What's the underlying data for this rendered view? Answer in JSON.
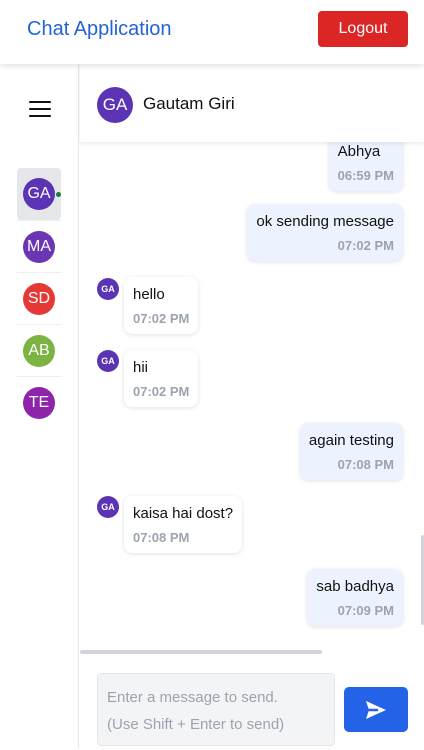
{
  "app": {
    "title": "Chat Application",
    "logout_label": "Logout"
  },
  "sidebar": {
    "menu_icon": "hamburger-menu-icon",
    "contacts": [
      {
        "initials": "GA",
        "color": "#5b34b5",
        "active": true,
        "online": true
      },
      {
        "initials": "MA",
        "color": "#6a36b4"
      },
      {
        "initials": "SD",
        "color": "#e53935"
      },
      {
        "initials": "AB",
        "color": "#7cb342"
      },
      {
        "initials": "TE",
        "color": "#8e24aa"
      }
    ]
  },
  "chat": {
    "contact_initials": "GA",
    "contact_name": "Gautam Giri",
    "messages": [
      {
        "text": "Abhya",
        "time": "06:59 PM",
        "direction": "out"
      },
      {
        "text": "ok sending message",
        "time": "07:02 PM",
        "direction": "out"
      },
      {
        "sender_initials": "GA",
        "text": "hello",
        "time": "07:02 PM",
        "direction": "in"
      },
      {
        "sender_initials": "GA",
        "text": "hii",
        "time": "07:02 PM",
        "direction": "in"
      },
      {
        "text": "again testing",
        "time": "07:08 PM",
        "direction": "out"
      },
      {
        "sender_initials": "GA",
        "text": "kaisa hai dost?",
        "time": "07:08 PM",
        "direction": "in"
      },
      {
        "text": "sab badhya",
        "time": "07:09 PM",
        "direction": "out"
      }
    ]
  },
  "composer": {
    "placeholder": "Enter a message to send.\n(Use Shift + Enter to send)",
    "value": "",
    "send_icon": "send-icon"
  },
  "colors": {
    "accent": "#2463e8",
    "title": "#2463d6",
    "logout": "#dc2626",
    "outgoing_bubble": "#ecf3ff"
  }
}
